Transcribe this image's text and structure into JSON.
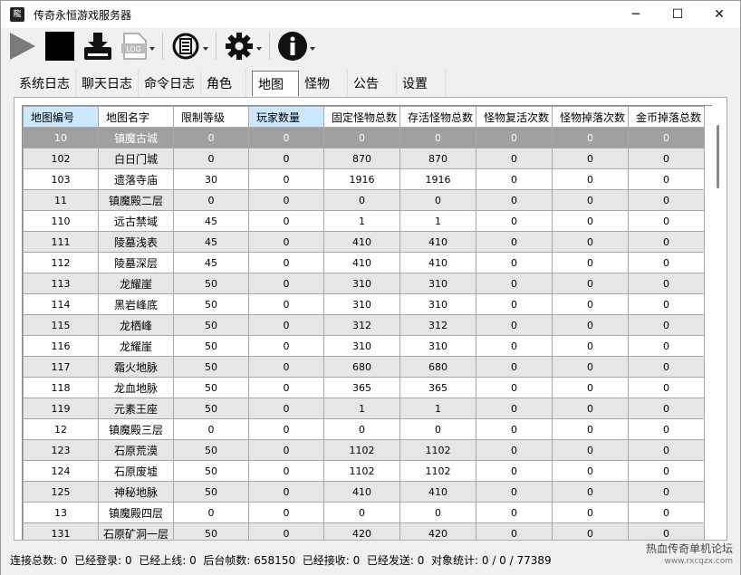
{
  "window": {
    "app_icon": "龍",
    "title": "传奇永恒游戏服务器",
    "controls": {
      "minimize": "─",
      "maximize": "☐",
      "close": "✕"
    }
  },
  "toolbar": {
    "buttons": [
      {
        "icon": "play-icon"
      },
      {
        "icon": "stop-icon"
      },
      {
        "icon": "download-icon"
      },
      {
        "icon": "log-icon",
        "label": "LOG"
      },
      {
        "icon": "list-icon"
      },
      {
        "icon": "gear-icon"
      },
      {
        "icon": "info-icon"
      }
    ]
  },
  "tabs": [
    "系统日志",
    "聊天日志",
    "命令日志",
    "角色",
    "地图",
    "怪物",
    "公告",
    "设置"
  ],
  "active_tab": "地图",
  "table": {
    "columns": [
      "地图编号",
      "地图名字",
      "限制等级",
      "玩家数量",
      "固定怪物总数",
      "存活怪物总数",
      "怪物复活次数",
      "怪物掉落次数",
      "金币掉落总数"
    ],
    "rows": [
      [
        "10",
        "镇魔古城",
        "0",
        "0",
        "0",
        "0",
        "0",
        "0",
        "0"
      ],
      [
        "102",
        "白日门城",
        "0",
        "0",
        "870",
        "870",
        "0",
        "0",
        "0"
      ],
      [
        "103",
        "遗落寺庙",
        "30",
        "0",
        "1916",
        "1916",
        "0",
        "0",
        "0"
      ],
      [
        "11",
        "镇魔殿二层",
        "0",
        "0",
        "0",
        "0",
        "0",
        "0",
        "0"
      ],
      [
        "110",
        "远古禁域",
        "45",
        "0",
        "1",
        "1",
        "0",
        "0",
        "0"
      ],
      [
        "111",
        "陵墓浅表",
        "45",
        "0",
        "410",
        "410",
        "0",
        "0",
        "0"
      ],
      [
        "112",
        "陵墓深层",
        "45",
        "0",
        "410",
        "410",
        "0",
        "0",
        "0"
      ],
      [
        "113",
        "龙耀崖",
        "50",
        "0",
        "310",
        "310",
        "0",
        "0",
        "0"
      ],
      [
        "114",
        "黑岩峰底",
        "50",
        "0",
        "310",
        "310",
        "0",
        "0",
        "0"
      ],
      [
        "115",
        "龙栖峰",
        "50",
        "0",
        "312",
        "312",
        "0",
        "0",
        "0"
      ],
      [
        "116",
        "龙耀崖",
        "50",
        "0",
        "310",
        "310",
        "0",
        "0",
        "0"
      ],
      [
        "117",
        "霜火地脉",
        "50",
        "0",
        "680",
        "680",
        "0",
        "0",
        "0"
      ],
      [
        "118",
        "龙血地脉",
        "50",
        "0",
        "365",
        "365",
        "0",
        "0",
        "0"
      ],
      [
        "119",
        "元素王座",
        "50",
        "0",
        "1",
        "1",
        "0",
        "0",
        "0"
      ],
      [
        "12",
        "镇魔殿三层",
        "0",
        "0",
        "0",
        "0",
        "0",
        "0",
        "0"
      ],
      [
        "123",
        "石原荒漠",
        "50",
        "0",
        "1102",
        "1102",
        "0",
        "0",
        "0"
      ],
      [
        "124",
        "石原废墟",
        "50",
        "0",
        "1102",
        "1102",
        "0",
        "0",
        "0"
      ],
      [
        "125",
        "神秘地脉",
        "50",
        "0",
        "410",
        "410",
        "0",
        "0",
        "0"
      ],
      [
        "13",
        "镇魔殿四层",
        "0",
        "0",
        "0",
        "0",
        "0",
        "0",
        "0"
      ],
      [
        "131",
        "石原矿洞一层",
        "50",
        "0",
        "420",
        "420",
        "0",
        "0",
        "0"
      ]
    ]
  },
  "status": {
    "connections": "连接总数: 0",
    "logged_in": "已经登录: 0",
    "online": "已经上线: 0",
    "fps": "后台帧数: 658150",
    "received": "已经接收: 0",
    "sent": "已经发送: 0",
    "objects": "对象统计: 0 / 0 / 77389"
  },
  "watermark": {
    "main": "热血传奇单机论坛",
    "sub": "www.rxcqzx.com"
  },
  "colors": {
    "selected_row": "#a0a0a0",
    "header_selected": "#cce8ff",
    "alt_row": "#e6e6e6"
  }
}
